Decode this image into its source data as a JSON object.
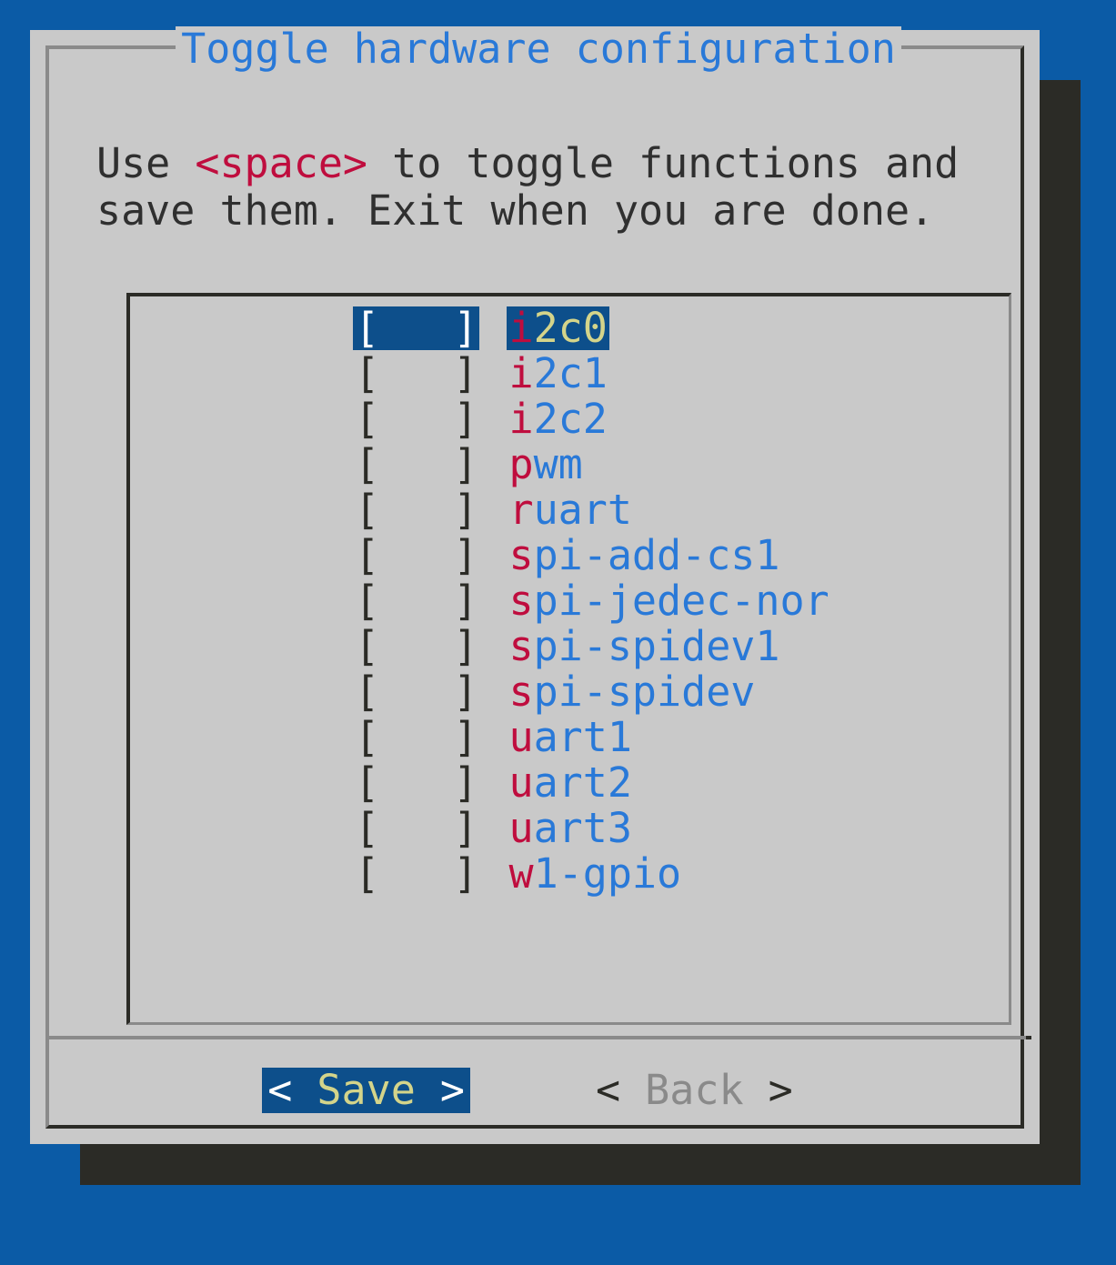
{
  "window": {
    "title": "Toggle hardware configuration",
    "backdrop_color": "#0b5ba6",
    "panel_color": "#c9c9c9",
    "shadow_color": "#2b2b26"
  },
  "instructions": {
    "line1_pre": "Use ",
    "line1_key": "<space>",
    "line1_post": " to toggle functions and",
    "line2": "save them. Exit when you are done."
  },
  "list": {
    "checkbox_unchecked": "[   ]",
    "items": [
      {
        "hotkey": "i",
        "rest": "2c0",
        "full": "i2c0",
        "checked": false,
        "selected": true
      },
      {
        "hotkey": "i",
        "rest": "2c1",
        "full": "i2c1",
        "checked": false,
        "selected": false
      },
      {
        "hotkey": "i",
        "rest": "2c2",
        "full": "i2c2",
        "checked": false,
        "selected": false
      },
      {
        "hotkey": "p",
        "rest": "wm",
        "full": "pwm",
        "checked": false,
        "selected": false
      },
      {
        "hotkey": "r",
        "rest": "uart",
        "full": "ruart",
        "checked": false,
        "selected": false
      },
      {
        "hotkey": "s",
        "rest": "pi-add-cs1",
        "full": "spi-add-cs1",
        "checked": false,
        "selected": false
      },
      {
        "hotkey": "s",
        "rest": "pi-jedec-nor",
        "full": "spi-jedec-nor",
        "checked": false,
        "selected": false
      },
      {
        "hotkey": "s",
        "rest": "pi-spidev1",
        "full": "spi-spidev1",
        "checked": false,
        "selected": false
      },
      {
        "hotkey": "s",
        "rest": "pi-spidev",
        "full": "spi-spidev",
        "checked": false,
        "selected": false
      },
      {
        "hotkey": "u",
        "rest": "art1",
        "full": "uart1",
        "checked": false,
        "selected": false
      },
      {
        "hotkey": "u",
        "rest": "art2",
        "full": "uart2",
        "checked": false,
        "selected": false
      },
      {
        "hotkey": "u",
        "rest": "art3",
        "full": "uart3",
        "checked": false,
        "selected": false
      },
      {
        "hotkey": "w",
        "rest": "1-gpio",
        "full": "w1-gpio",
        "checked": false,
        "selected": false
      }
    ]
  },
  "buttons": {
    "save": {
      "left_bracket": "<",
      "label": " Save ",
      "right_bracket": ">",
      "focused": true
    },
    "back": {
      "left_bracket": "<",
      "label": " Back ",
      "right_bracket": ">",
      "focused": false
    }
  },
  "colors": {
    "title_blue": "#2979d8",
    "hotkey_red": "#bf0d3e",
    "item_blue": "#2979d8",
    "selection_blue": "#0d4f8b",
    "selected_text_yellow": "#d4d48a",
    "text_dark": "#2f2f2f",
    "border_light": "#8a8a8a",
    "border_dark": "#2b2b26"
  }
}
